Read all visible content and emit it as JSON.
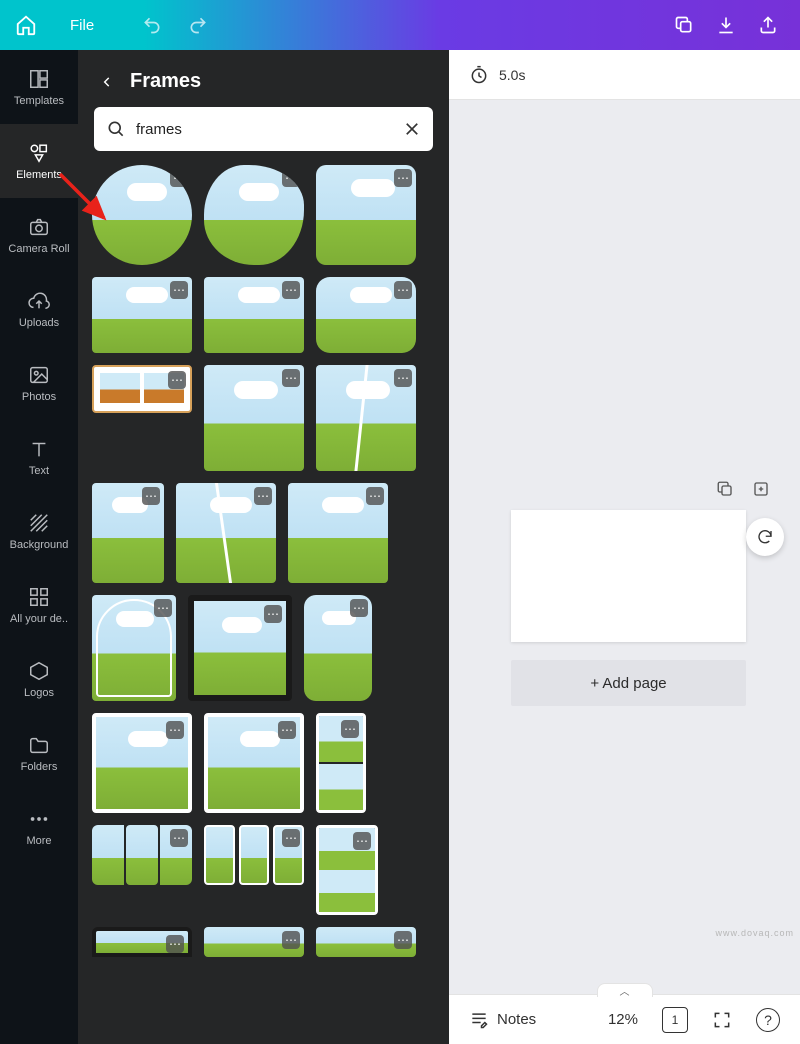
{
  "topbar": {
    "file_label": "File"
  },
  "rail": {
    "templates": "Templates",
    "elements": "Elements",
    "camera_roll": "Camera Roll",
    "uploads": "Uploads",
    "photos": "Photos",
    "text": "Text",
    "background": "Background",
    "all_designs": "All your de..",
    "logos": "Logos",
    "folders": "Folders",
    "more": "More"
  },
  "panel": {
    "title": "Frames",
    "search_value": "frames"
  },
  "canvas": {
    "duration": "5.0s",
    "add_page": "+ Add page"
  },
  "bottombar": {
    "notes": "Notes",
    "zoom": "12%",
    "page_num": "1",
    "help": "?"
  },
  "watermark": "www.dovaq.com"
}
